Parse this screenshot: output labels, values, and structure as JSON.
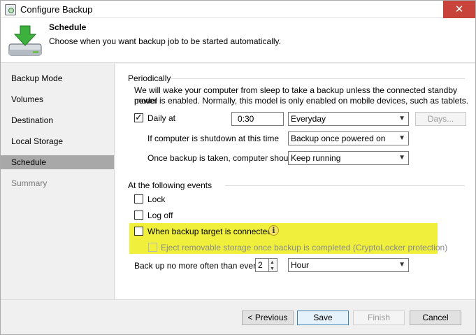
{
  "window": {
    "title": "Configure Backup",
    "close_glyph": "✕"
  },
  "header": {
    "title": "Schedule",
    "subtitle": "Choose when you want backup job to be started automatically.",
    "icon": "download-drive-icon"
  },
  "sidebar": {
    "items": [
      {
        "label": "Backup Mode",
        "state": "normal"
      },
      {
        "label": "Volumes",
        "state": "normal"
      },
      {
        "label": "Destination",
        "state": "normal"
      },
      {
        "label": "Local Storage",
        "state": "normal"
      },
      {
        "label": "Schedule",
        "state": "selected"
      },
      {
        "label": "Summary",
        "state": "disabled"
      }
    ]
  },
  "periodically": {
    "title": "Periodically",
    "description_line1": "We will wake your computer from sleep to take a backup unless the connected standby power",
    "description_line2": "model is enabled. Normally, this model is only enabled on mobile devices, such as tablets.",
    "daily_label": "Daily at",
    "daily_checked": true,
    "time_value": "0:30",
    "frequency_value": "Everyday",
    "days_button": "Days...",
    "shutdown_label": "If computer is shutdown at this time",
    "shutdown_value": "Backup once powered on",
    "after_label": "Once backup is taken, computer should",
    "after_value": "Keep running"
  },
  "events": {
    "title": "At the following events",
    "lock_label": "Lock",
    "logoff_label": "Log off",
    "target_label": "When backup target is connected",
    "eject_label": "Eject removable storage once backup is completed (CryptoLocker protection)",
    "info_glyph": "i",
    "limit_label": "Back up no more often than every",
    "limit_value": "2",
    "limit_unit": "Hour"
  },
  "footer": {
    "previous": "< Previous",
    "save": "Save",
    "finish": "Finish",
    "cancel": "Cancel"
  },
  "colors": {
    "highlight": "#f0f03c",
    "selected_nav": "#a8a8a8",
    "close_button": "#c8433a"
  }
}
